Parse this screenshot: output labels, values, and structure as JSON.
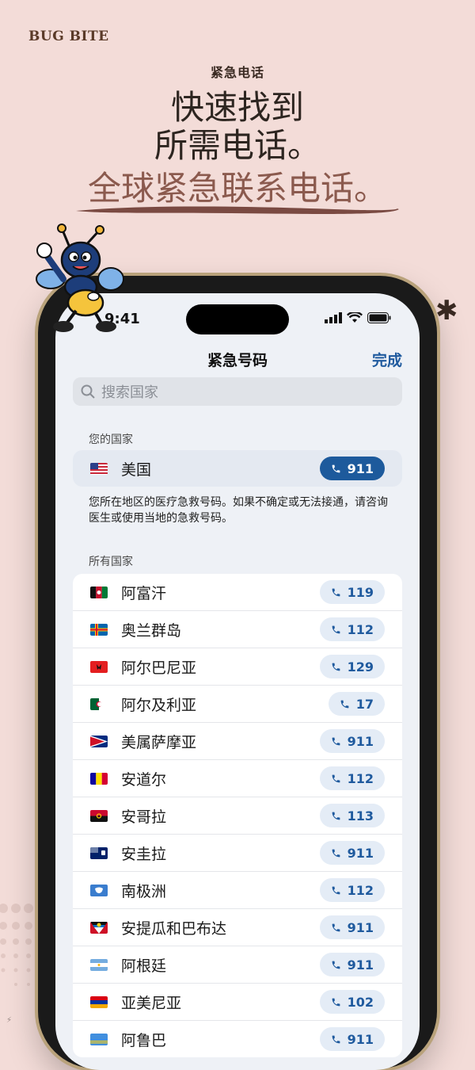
{
  "brand": "BUG BITE",
  "hero": {
    "eyebrow": "紧急电话",
    "line1": "快速找到",
    "line2": "所需电话。",
    "line3": "全球紧急联系电话。"
  },
  "status_bar": {
    "time": "9:41"
  },
  "nav": {
    "title": "紧急号码",
    "done_label": "完成"
  },
  "search": {
    "placeholder": "搜索国家"
  },
  "your_country": {
    "section_label": "您的国家",
    "country": "美国",
    "number": "911",
    "note": "您所在地区的医疗急救号码。如果不确定或无法接通，请咨询医生或使用当地的急救号码。"
  },
  "all_countries": {
    "section_label": "所有国家",
    "items": [
      {
        "name": "阿富汗",
        "number": "119",
        "flag": "af"
      },
      {
        "name": "奥兰群岛",
        "number": "112",
        "flag": "ax"
      },
      {
        "name": "阿尔巴尼亚",
        "number": "129",
        "flag": "al"
      },
      {
        "name": "阿尔及利亚",
        "number": "17",
        "flag": "dz"
      },
      {
        "name": "美属萨摩亚",
        "number": "911",
        "flag": "as"
      },
      {
        "name": "安道尔",
        "number": "112",
        "flag": "ad"
      },
      {
        "name": "安哥拉",
        "number": "113",
        "flag": "ao"
      },
      {
        "name": "安圭拉",
        "number": "911",
        "flag": "ai"
      },
      {
        "name": "南极洲",
        "number": "112",
        "flag": "aq"
      },
      {
        "name": "安提瓜和巴布达",
        "number": "911",
        "flag": "ag"
      },
      {
        "name": "阿根廷",
        "number": "911",
        "flag": "ar"
      },
      {
        "name": "亚美尼亚",
        "number": "102",
        "flag": "am"
      },
      {
        "name": "阿鲁巴",
        "number": "911",
        "flag": "aw"
      }
    ]
  },
  "colors": {
    "background": "#f3dcd8",
    "accent": "#1d5a9c",
    "headline_highlight": "#8b5a4e"
  }
}
